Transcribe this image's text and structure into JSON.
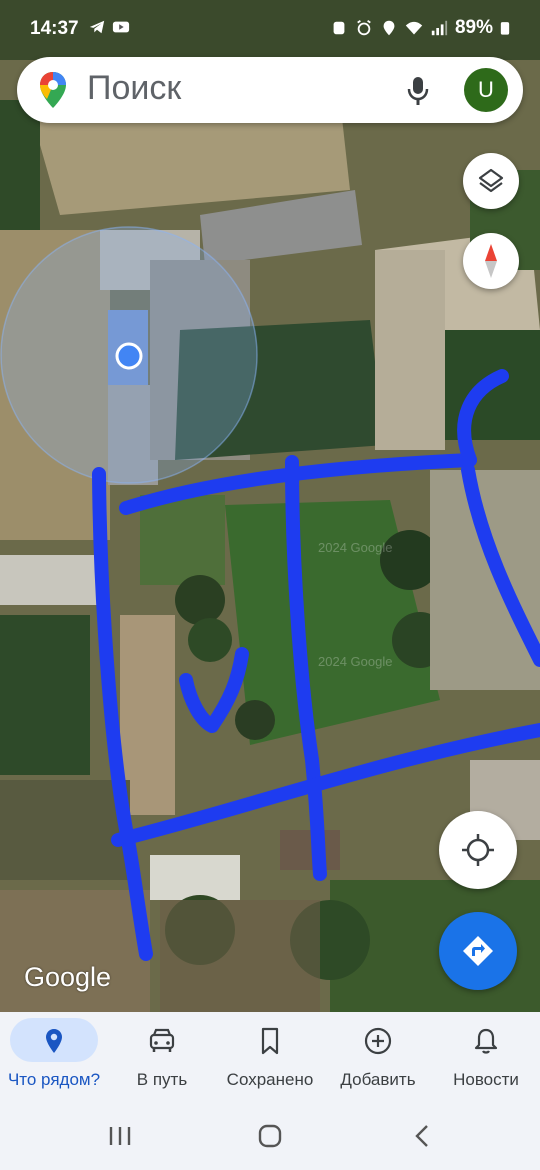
{
  "status_bar": {
    "time": "14:37",
    "battery": "89%",
    "left_icons": [
      "telegram-icon",
      "youtube-icon"
    ],
    "right_icons": [
      "app-icon",
      "alarm-icon",
      "location-icon",
      "wifi-icon",
      "signal-icon",
      "battery-icon"
    ]
  },
  "search": {
    "placeholder": "Поиск",
    "avatar_initial": "U"
  },
  "map": {
    "attribution": "Google",
    "watermark": "2024 Google",
    "type": "satellite",
    "colors": {
      "drawn_lines": "#1e3cf0",
      "location_dot": "#4285f4",
      "accuracy_circle": "#8ab4f8"
    }
  },
  "controls": {
    "layers": "layers-icon",
    "compass": "compass-icon",
    "my_location": "my-location-icon",
    "directions": "directions-icon"
  },
  "bottom_nav": {
    "items": [
      {
        "label": "Что рядом?",
        "icon": "pin-icon",
        "active": true
      },
      {
        "label": "В путь",
        "icon": "car-icon",
        "active": false
      },
      {
        "label": "Сохранено",
        "icon": "bookmark-icon",
        "active": false
      },
      {
        "label": "Добавить",
        "icon": "add-circle-icon",
        "active": false
      },
      {
        "label": "Новости",
        "icon": "bell-icon",
        "active": false
      }
    ]
  },
  "system_nav": [
    "recents-icon",
    "home-icon",
    "back-icon"
  ]
}
